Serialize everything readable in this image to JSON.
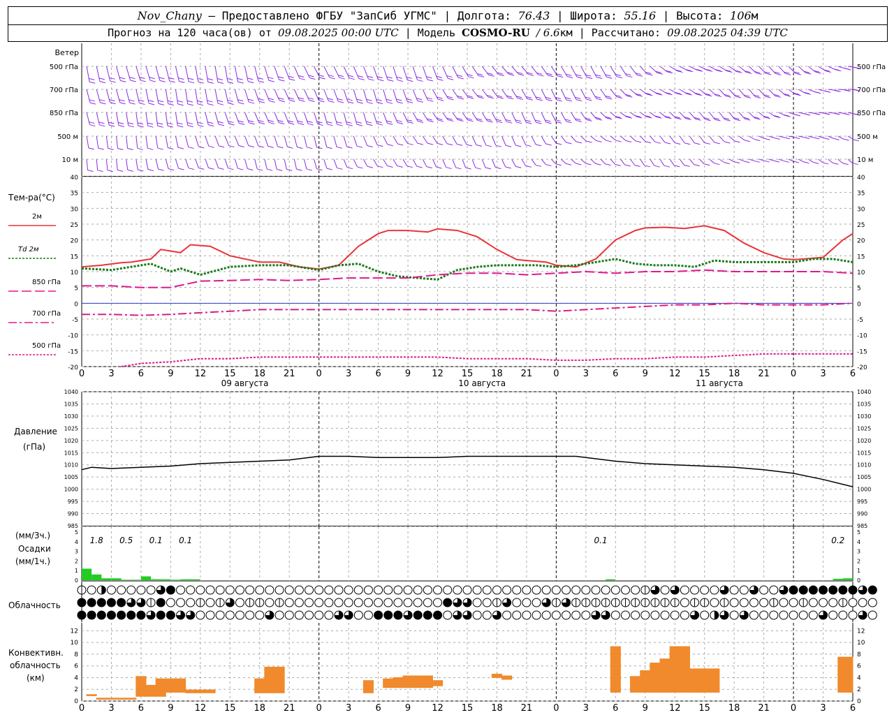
{
  "header": {
    "station": "Nov_Chany",
    "provided_by": "– Предоставлено ФГБУ \"ЗапСиб УГМС\" |",
    "lon_label": "Долгота:",
    "lon": "76.43",
    "lat_label": "| Широта:",
    "lat": "55.16",
    "alt_label": "| Высота:",
    "alt": "106",
    "alt_unit": "м",
    "forecast_label": "Прогноз на 120 часа(ов) от",
    "forecast_from": "09.08.2025 00:00 UTC",
    "model_label": "| Модель",
    "model": "COSMO-RU",
    "resolution": "/ 6.6",
    "resolution_unit": "км",
    "computed_label": "| Рассчитано:",
    "computed": "09.08.2025 04:39 UTC"
  },
  "chart_data": [
    {
      "panel": "wind",
      "type": "wind-barbs",
      "label": "Ветер",
      "levels": [
        "500 гПа",
        "700 гПа",
        "850 гПа",
        "500 м",
        "10  м"
      ],
      "color": "#8a2be2"
    },
    {
      "panel": "temperature",
      "type": "line",
      "label": "Тем-ра(°C)",
      "ylim": [
        -20,
        40
      ],
      "yticks": [
        40,
        35,
        30,
        25,
        20,
        15,
        10,
        5,
        0,
        -5,
        -10,
        -15,
        -20
      ],
      "x_hours": [
        0,
        3,
        6,
        9,
        12,
        15,
        18,
        21,
        24,
        27,
        30,
        33,
        36,
        39,
        42,
        45,
        48,
        51,
        54,
        57,
        60,
        63,
        66,
        69,
        72,
        75,
        78
      ],
      "xtick_labels": [
        "0",
        "3",
        "6",
        "9",
        "12",
        "15",
        "18",
        "21",
        "0",
        "3",
        "6",
        "9",
        "12",
        "15",
        "18",
        "21",
        "0",
        "3",
        "6",
        "9",
        "12",
        "15",
        "18",
        "21",
        "0",
        "3",
        "6"
      ],
      "day_labels": [
        {
          "hour": 16.5,
          "text": "09 августа"
        },
        {
          "hour": 40.5,
          "text": "10 августа"
        },
        {
          "hour": 64.5,
          "text": "11 августа"
        }
      ],
      "series": [
        {
          "name": "2м",
          "color": "#e8343a",
          "style": "solid",
          "x": [
            0,
            2,
            4,
            5,
            7,
            8,
            10,
            11,
            13,
            15,
            18,
            20,
            22,
            24,
            26,
            28,
            30,
            31,
            33,
            35,
            36,
            38,
            40,
            42,
            44,
            45,
            47,
            48,
            50,
            52,
            54,
            56,
            57,
            59,
            61,
            63,
            65,
            67,
            69,
            71,
            72,
            73,
            75,
            77,
            78
          ],
          "values": [
            11.5,
            12,
            12.8,
            13,
            14,
            17,
            16,
            18.5,
            18,
            15,
            13,
            13,
            11.5,
            10.8,
            12,
            18,
            22,
            23,
            23,
            22.5,
            23.5,
            23,
            21,
            17,
            13.8,
            13.5,
            13,
            12,
            11.5,
            14,
            20,
            23,
            23.8,
            24,
            23.6,
            24.5,
            23,
            19,
            16,
            14,
            13.8,
            14,
            14.5,
            20,
            22
          ]
        },
        {
          "name": "Td 2м",
          "color": "#1a7a1a",
          "style": "dotted",
          "x": [
            0,
            3,
            6,
            7,
            9,
            10,
            12,
            15,
            18,
            21,
            24,
            26,
            28,
            30,
            32,
            34,
            36,
            38,
            40,
            42,
            44,
            46,
            48,
            50,
            52,
            54,
            56,
            58,
            60,
            62,
            64,
            66,
            68,
            70,
            72,
            74,
            76,
            78
          ],
          "values": [
            11,
            10.5,
            12,
            12.5,
            10,
            11,
            9,
            11.5,
            12,
            12,
            10.5,
            12,
            12.5,
            10,
            8.5,
            8,
            7.5,
            10.5,
            11.5,
            12,
            12,
            12,
            11.5,
            12,
            13,
            14,
            12.5,
            12,
            12,
            11.5,
            13.5,
            13,
            13,
            13,
            13,
            14,
            14,
            13
          ]
        },
        {
          "name": "850 гПа",
          "color": "#e0188c",
          "style": "long-dash",
          "x": [
            0,
            3,
            6,
            9,
            12,
            15,
            18,
            21,
            24,
            27,
            30,
            33,
            36,
            39,
            42,
            45,
            48,
            51,
            54,
            57,
            60,
            63,
            66,
            69,
            72,
            75,
            78
          ],
          "values": [
            5.5,
            5.5,
            5,
            5,
            7,
            7.2,
            7.5,
            7.2,
            7.5,
            8,
            8,
            8,
            9,
            9.5,
            9.5,
            9,
            9.5,
            10,
            9.5,
            10,
            10,
            10.5,
            10,
            10,
            10,
            10,
            9.5
          ]
        },
        {
          "name": "700 гПа",
          "color": "#e0188c",
          "style": "dash-dot",
          "x": [
            0,
            3,
            6,
            9,
            12,
            15,
            18,
            21,
            24,
            27,
            30,
            33,
            36,
            39,
            42,
            45,
            48,
            51,
            54,
            57,
            60,
            63,
            66,
            69,
            72,
            75,
            78
          ],
          "values": [
            -3.5,
            -3.5,
            -3.8,
            -3.5,
            -3,
            -2.5,
            -2,
            -2,
            -2,
            -2,
            -2,
            -2,
            -2,
            -2,
            -2,
            -2,
            -2.5,
            -2,
            -1.5,
            -1,
            -0.5,
            -0.5,
            0,
            -0.5,
            -0.5,
            -0.5,
            0
          ]
        },
        {
          "name": "500 гПа",
          "color": "#e0188c",
          "style": "dotted",
          "x": [
            4,
            6,
            9,
            12,
            15,
            18,
            21,
            24,
            27,
            30,
            33,
            36,
            39,
            42,
            45,
            48,
            51,
            54,
            57,
            60,
            63,
            66,
            69,
            72,
            75,
            78
          ],
          "values": [
            -20,
            -19,
            -18.5,
            -17.5,
            -17.5,
            -17,
            -17,
            -17,
            -17,
            -17,
            -17,
            -17,
            -17.5,
            -17.5,
            -17.5,
            -18,
            -18,
            -17.5,
            -17.5,
            -17,
            -17,
            -16.5,
            -16,
            -16,
            -16,
            -16
          ]
        }
      ]
    },
    {
      "panel": "pressure",
      "type": "line",
      "label": "Давление",
      "unit": "(гПа)",
      "ylim": [
        985,
        1040
      ],
      "yticks": [
        1040,
        1035,
        1030,
        1025,
        1020,
        1015,
        1010,
        1005,
        1000,
        995,
        990,
        985
      ],
      "x": [
        0,
        1,
        3,
        6,
        9,
        12,
        15,
        18,
        21,
        24,
        27,
        30,
        33,
        36,
        39,
        42,
        45,
        48,
        50,
        54,
        57,
        60,
        63,
        66,
        69,
        72,
        75,
        78
      ],
      "values": [
        1008,
        1009,
        1008.5,
        1009,
        1009.5,
        1010.5,
        1011,
        1011.5,
        1012,
        1013.5,
        1013.5,
        1013,
        1013,
        1013,
        1013.5,
        1013.5,
        1013.5,
        1013.5,
        1013.5,
        1011.5,
        1010.5,
        1010,
        1009.5,
        1009,
        1008,
        1006.5,
        1004,
        1001
      ]
    },
    {
      "panel": "precipitation",
      "type": "bar",
      "label_top": "(мм/3ч.)",
      "label": "Осадки",
      "unit": "(мм/1ч.)",
      "ylim": [
        0,
        5
      ],
      "yticks": [
        5,
        4,
        3,
        2,
        1,
        0
      ],
      "color": "#22cc22",
      "x_hours": [
        0,
        1,
        2,
        3,
        4,
        5,
        6,
        7,
        8,
        9,
        10,
        11,
        53,
        76,
        77
      ],
      "values_mm_per_h": [
        1.2,
        0.6,
        0.2,
        0.2,
        0.05,
        0.05,
        0.4,
        0.1,
        0.1,
        0.05,
        0.1,
        0.1,
        0.1,
        0.15,
        0.2
      ],
      "totals_3h": [
        {
          "hour": 1.5,
          "text": "1.8"
        },
        {
          "hour": 4.5,
          "text": "0.5"
        },
        {
          "hour": 7.5,
          "text": "0.1"
        },
        {
          "hour": 10.5,
          "text": "0.1"
        },
        {
          "hour": 52.5,
          "text": "0.1"
        },
        {
          "hour": 76.5,
          "text": "0.2"
        }
      ]
    },
    {
      "panel": "cloudiness",
      "type": "cloud-cover-symbols",
      "label": "Облачность",
      "rows": [
        "upper",
        "middle",
        "low"
      ],
      "values_hourly_oktas_scale_0_4": {
        "upper": [
          1,
          0,
          2,
          0,
          0,
          0,
          0,
          0,
          3,
          4,
          0,
          0,
          0,
          0,
          0,
          0,
          0,
          0,
          0,
          0,
          0,
          0,
          0,
          0,
          0,
          0,
          0,
          0,
          0,
          0,
          0,
          0,
          0,
          0,
          0,
          0,
          0,
          0,
          0,
          0,
          0,
          0,
          0,
          0,
          0,
          0,
          0,
          0,
          0,
          0,
          0,
          0,
          0,
          0,
          0,
          0,
          0,
          1,
          3,
          0,
          3,
          0,
          0,
          0,
          0,
          3,
          0,
          0,
          3,
          0,
          0,
          3,
          4,
          4,
          4,
          4,
          4,
          4,
          4,
          3,
          4
        ],
        "middle": [
          4,
          4,
          4,
          4,
          4,
          3,
          3,
          1,
          4,
          0,
          0,
          0,
          1,
          0,
          1,
          3,
          0,
          1,
          1,
          0,
          1,
          0,
          0,
          0,
          0,
          0,
          0,
          0,
          0,
          0,
          0,
          0,
          0,
          0,
          0,
          0,
          0,
          4,
          3,
          3,
          0,
          0,
          1,
          3,
          0,
          0,
          0,
          3,
          1,
          3,
          1,
          1,
          1,
          1,
          1,
          1,
          1,
          1,
          1,
          1,
          1,
          0,
          1,
          1,
          0,
          1,
          0,
          0,
          0,
          0,
          1,
          0,
          0,
          1,
          0,
          0,
          0,
          1,
          0,
          0,
          0
        ],
        "low": [
          4,
          4,
          4,
          4,
          4,
          4,
          4,
          3,
          4,
          4,
          3,
          3,
          0,
          0,
          0,
          0,
          0,
          0,
          0,
          3,
          0,
          0,
          0,
          0,
          0,
          0,
          3,
          3,
          0,
          0,
          4,
          4,
          4,
          3,
          4,
          4,
          4,
          0,
          3,
          3,
          0,
          0,
          3,
          0,
          0,
          0,
          0,
          0,
          0,
          0,
          0,
          0,
          3,
          3,
          0,
          0,
          0,
          0,
          0,
          0,
          0,
          0,
          3,
          0,
          2,
          3,
          0,
          3,
          0,
          0,
          0,
          0,
          0,
          0,
          0,
          3,
          0,
          0,
          0,
          3,
          0
        ]
      }
    },
    {
      "panel": "convective",
      "type": "bar",
      "label": "Конвективн. облачность (км)",
      "label_lines": [
        "Конвективн.",
        "облачность",
        "(км)"
      ],
      "ylim": [
        0,
        13
      ],
      "yticks": [
        12,
        10,
        8,
        6,
        4,
        2,
        0
      ],
      "color": "#f08a2c",
      "bars": [
        {
          "from": 0.5,
          "to": 1.5,
          "bottom": 0.9,
          "top": 1.1
        },
        {
          "from": 1.5,
          "to": 5.5,
          "bottom": 0.3,
          "top": 0.5
        },
        {
          "from": 5.5,
          "to": 6.5,
          "bottom": 0.8,
          "top": 4.2
        },
        {
          "from": 6.5,
          "to": 7.5,
          "bottom": 0.8,
          "top": 2.7
        },
        {
          "from": 7.5,
          "to": 8.5,
          "bottom": 0.8,
          "top": 3.8
        },
        {
          "from": 8.5,
          "to": 10.5,
          "bottom": 1.5,
          "top": 3.8
        },
        {
          "from": 10.5,
          "to": 13.5,
          "bottom": 1.4,
          "top": 1.9
        },
        {
          "from": 17.5,
          "to": 18.5,
          "bottom": 1.4,
          "top": 3.8
        },
        {
          "from": 18.5,
          "to": 20.5,
          "bottom": 1.4,
          "top": 5.8
        },
        {
          "from": 28.5,
          "to": 29.5,
          "bottom": 1.4,
          "top": 3.5
        },
        {
          "from": 30.5,
          "to": 31.5,
          "bottom": 2.3,
          "top": 3.8
        },
        {
          "from": 31.5,
          "to": 32.5,
          "bottom": 2.3,
          "top": 4.0
        },
        {
          "from": 32.5,
          "to": 35.5,
          "bottom": 2.3,
          "top": 4.3
        },
        {
          "from": 35.5,
          "to": 36.5,
          "bottom": 2.6,
          "top": 3.5
        },
        {
          "from": 41.5,
          "to": 42.5,
          "bottom": 4.0,
          "top": 4.6
        },
        {
          "from": 42.5,
          "to": 43.5,
          "bottom": 3.7,
          "top": 4.3
        },
        {
          "from": 53.5,
          "to": 54.5,
          "bottom": 1.5,
          "top": 9.3
        },
        {
          "from": 55.5,
          "to": 56.5,
          "bottom": 1.5,
          "top": 4.2
        },
        {
          "from": 56.5,
          "to": 57.5,
          "bottom": 1.5,
          "top": 5.2
        },
        {
          "from": 57.5,
          "to": 58.5,
          "bottom": 1.5,
          "top": 6.5
        },
        {
          "from": 58.5,
          "to": 59.5,
          "bottom": 1.5,
          "top": 7.2
        },
        {
          "from": 59.5,
          "to": 60.5,
          "bottom": 1.5,
          "top": 9.3
        },
        {
          "from": 60.5,
          "to": 61.5,
          "bottom": 1.5,
          "top": 9.3
        },
        {
          "from": 61.5,
          "to": 62.5,
          "bottom": 1.5,
          "top": 5.5
        },
        {
          "from": 62.5,
          "to": 64.5,
          "bottom": 1.5,
          "top": 5.5
        },
        {
          "from": 76.5,
          "to": 78,
          "bottom": 1.5,
          "top": 7.5
        }
      ],
      "xtick_labels": [
        "0",
        "3",
        "6",
        "9",
        "12",
        "15",
        "18",
        "21",
        "0",
        "3",
        "6",
        "9",
        "12",
        "15",
        "18",
        "21",
        "0",
        "3",
        "6",
        "9",
        "12",
        "15",
        "18",
        "21",
        "0",
        "3",
        "6"
      ]
    }
  ]
}
